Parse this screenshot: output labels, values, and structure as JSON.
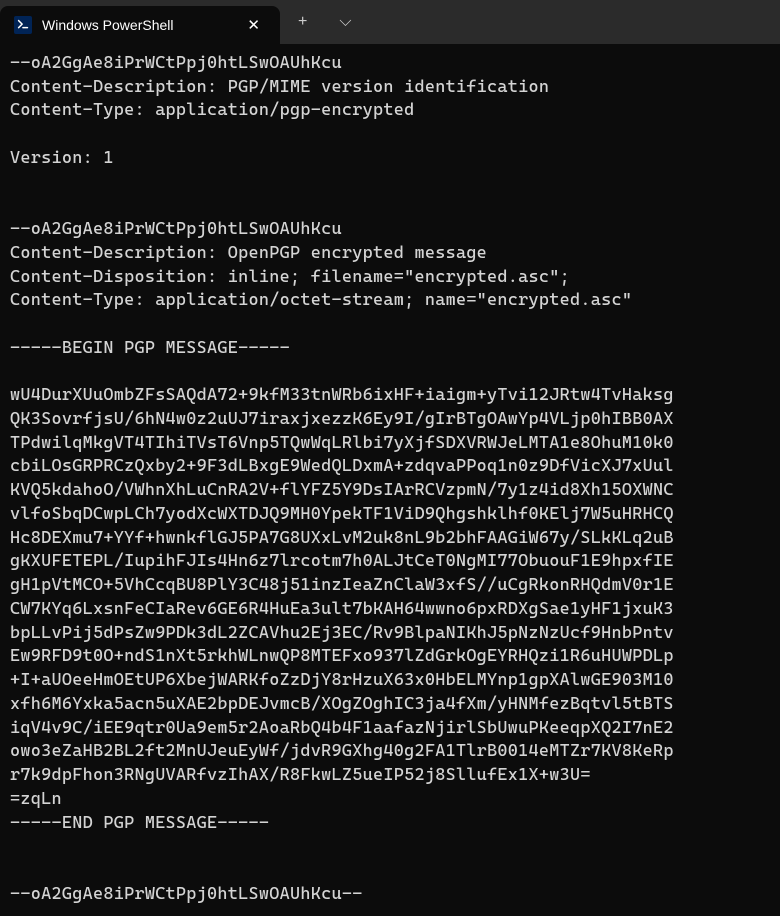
{
  "titlebar": {
    "tab_title": "Windows PowerShell",
    "close_label": "✕",
    "new_tab_label": "+",
    "dropdown_label": "⌵"
  },
  "terminal": {
    "content": "--oA2GgAe8iPrWCtPpj0htLSwOAUhKcu\nContent-Description: PGP/MIME version identification\nContent-Type: application/pgp-encrypted\n\nVersion: 1\n\n\n--oA2GgAe8iPrWCtPpj0htLSwOAUhKcu\nContent-Description: OpenPGP encrypted message\nContent-Disposition: inline; filename=\"encrypted.asc\";\nContent-Type: application/octet-stream; name=\"encrypted.asc\"\n\n-----BEGIN PGP MESSAGE-----\n\nwU4DurXUuOmbZFsSAQdA72+9kfM33tnWRb6ixHF+iaigm+yTvi12JRtw4TvHaksg\nQK3SovrfjsU/6hN4w0z2uUJ7iraxjxezzK6Ey9I/gIrBTgOAwYp4VLjp0hIBB0AX\nTPdwilqMkgVT4TIhiTVsT6Vnp5TQwWqLRlbi7yXjfSDXVRWJeLMTA1e8OhuM10k0\ncbiLOsGRPRCzQxby2+9F3dLBxgE9WedQLDxmA+zdqvaPPoq1n0z9DfVicXJ7xUul\nKVQ5kdahoO/VWhnXhLuCnRA2V+flYFZ5Y9DsIArRCVzpmN/7y1z4id8Xh15OXWNC\nvlfoSbqDCwpLCh7yodXcWXTDJQ9MH0YpekTF1ViD9Qhgshklhf0KElj7W5uHRHCQ\nHc8DEXmu7+YYf+hwnkflGJ5PA7G8UXxLvM2uk8nL9b2bhFAAGiW67y/SLkKLq2uB\ngKXUFETEPL/IupihFJIs4Hn6z7lrcotm7h0ALJtCeT0NgMI77ObuouF1E9hpxfIE\ngH1pVtMCO+5VhCcqBU8PlY3C48j51inzIeaZnClaW3xfS//uCgRkonRHQdmV0r1E\nCW7KYq6LxsnFeCIaRev6GE6R4HuEa3ult7bKAH64wwno6pxRDXgSae1yHF1jxuK3\nbpLLvPij5dPsZw9PDk3dL2ZCAVhu2Ej3EC/Rv9BlpaNIKhJ5pNzNzUcf9HnbPntv\nEw9RFD9t0O+ndS1nXt5rkhWLnwQP8MTEFxo937lZdGrkOgEYRHQzi1R6uHUWPDLp\n+I+aUOeeHmOEtUP6XbejWARKfoZzDjY8rHzuX63x0HbELMYnp1gpXAlwGE903M10\nxfh6M6Yxka5acn5uXAE2bpDEJvmcB/XOgZOghIC3ja4fXm/yHNMfezBqtvl5tBTS\niqV4v9C/iEE9qtr0Ua9em5r2AoaRbQ4b4F1aafazNjirlSbUwuPKeeqpXQ2I7nE2\nowo3eZaHB2BL2ft2MnUJeuEyWf/jdvR9GXhg40g2FA1TlrB0014eMTZr7KV8KeRp\nr7k9dpFhon3RNgUVARfvzIhAX/R8FkwLZ5ueIP52j8SllufEx1X+w3U=\n=zqLn\n-----END PGP MESSAGE-----\n\n\n--oA2GgAe8iPrWCtPpj0htLSwOAUhKcu--"
  }
}
